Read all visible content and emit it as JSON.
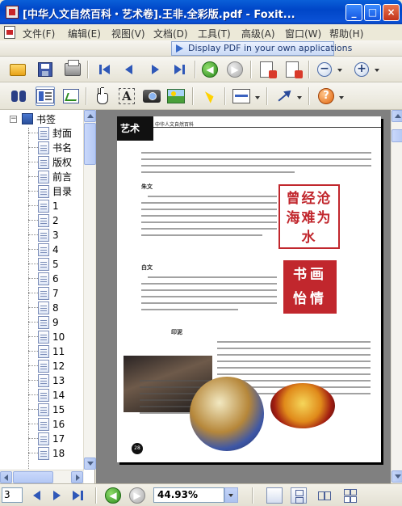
{
  "window": {
    "title": "[中华人文自然百科・艺术卷].王非.全彩版.pdf - Foxit...",
    "controls": {
      "minimize": "_",
      "maximize": "□",
      "close": "×"
    }
  },
  "menu": {
    "items": [
      "文件(F)",
      "编辑(E)",
      "视图(V)",
      "文档(D)",
      "工具(T)",
      "高级(A)",
      "窗口(W)",
      "帮助(H)"
    ]
  },
  "toolbar": {
    "banner": "Display PDF in your own applications",
    "icons": {
      "open": "open-folder-icon",
      "save": "save-disk-icon",
      "print": "print-icon",
      "first_page": "first-page-icon",
      "prev_page": "prev-page-icon",
      "next_page": "next-page-icon",
      "last_page": "last-page-icon",
      "back": "back-arrow-icon",
      "forward": "forward-arrow-icon",
      "zoom_out": "zoom-out-icon",
      "zoom_in": "zoom-in-icon",
      "find": "binoculars-icon",
      "bookmarks": "bookmark-panel-icon",
      "thumbnails": "thumbnail-panel-icon",
      "hand": "hand-tool-icon",
      "text_select": "text-select-icon",
      "snapshot": "camera-icon",
      "image": "image-tool-icon",
      "select": "select-cursor-icon",
      "note": "note-icon",
      "arrow": "arrow-tool-icon",
      "help": "help-icon"
    }
  },
  "bookmarks": {
    "root": "书签",
    "items": [
      "封面",
      "书名",
      "版权",
      "前言",
      "目录",
      "1",
      "2",
      "3",
      "4",
      "5",
      "6",
      "7",
      "8",
      "9",
      "10",
      "11",
      "12",
      "13",
      "14",
      "15",
      "16",
      "17",
      "18"
    ]
  },
  "page_content": {
    "header_tab": "艺术",
    "header_brand": "中华人文自然百科",
    "section_1": "朱文",
    "section_2": "白文",
    "section_3": "印泥",
    "page_number": "28",
    "seal_1": "曾经沧海难为水",
    "seal_2": "书画怡情"
  },
  "status": {
    "page_value": "3",
    "zoom_value": "44.93%"
  },
  "colors": {
    "titlebar": "#0046c8",
    "background": "#ece9d8",
    "doc_bg": "#808080",
    "seal_red": "#c1272d"
  }
}
